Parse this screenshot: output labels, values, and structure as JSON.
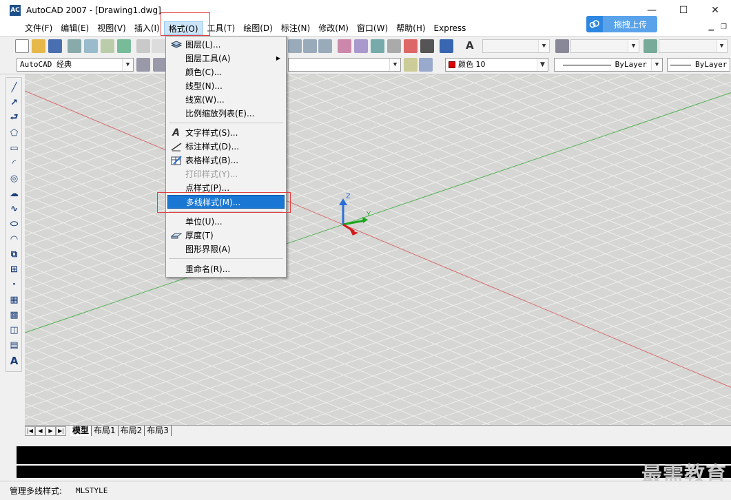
{
  "window": {
    "title": "AutoCAD 2007 - [Drawing1.dwg]",
    "app_icon_text": "AC",
    "minimize": "—",
    "maximize": "☐",
    "close": "✕",
    "cloud_button_label": "拖拽上传"
  },
  "menubar": {
    "items": [
      "文件(F)",
      "编辑(E)",
      "视图(V)",
      "插入(I)",
      "格式(O)",
      "工具(T)",
      "绘图(D)",
      "标注(N)",
      "修改(M)",
      "窗口(W)",
      "帮助(H)",
      "Express"
    ],
    "active_index": 4
  },
  "toolbar2": {
    "workspace": "AutoCAD 经典",
    "color_combo": "颜色 10",
    "linetype_combo": "ByLayer",
    "lineweight_combo": "ByLayer"
  },
  "format_menu": {
    "items": [
      {
        "label": "图层(L)...",
        "icon": "layers-icon",
        "disabled": false
      },
      {
        "label": "图层工具(A)",
        "icon": "",
        "disabled": false,
        "submenu": true
      },
      {
        "label": "颜色(C)...",
        "icon": "",
        "disabled": false
      },
      {
        "label": "线型(N)...",
        "icon": "",
        "disabled": false
      },
      {
        "label": "线宽(W)...",
        "icon": "",
        "disabled": false
      },
      {
        "label": "比例缩放列表(E)...",
        "icon": "",
        "disabled": false
      },
      {
        "label": "文字样式(S)...",
        "icon": "text-style-icon",
        "disabled": false
      },
      {
        "label": "标注样式(D)...",
        "icon": "dim-style-icon",
        "disabled": false
      },
      {
        "label": "表格样式(B)...",
        "icon": "table-style-icon",
        "disabled": false
      },
      {
        "label": "打印样式(Y)...",
        "icon": "",
        "disabled": true
      },
      {
        "label": "点样式(P)...",
        "icon": "",
        "disabled": false
      },
      {
        "label": "多线样式(M)...",
        "icon": "",
        "disabled": false,
        "selected": true
      },
      {
        "label": "单位(U)...",
        "icon": "",
        "disabled": false
      },
      {
        "label": "厚度(T)",
        "icon": "thickness-icon",
        "disabled": false
      },
      {
        "label": "图形界限(A)",
        "icon": "",
        "disabled": false
      },
      {
        "label": "重命名(R)...",
        "icon": "",
        "disabled": false
      }
    ]
  },
  "layout_tabs": [
    "模型",
    "布局1",
    "布局2",
    "布局3"
  ],
  "ucs": {
    "z": "Z",
    "y": "Y"
  },
  "status": {
    "label": "管理多线样式:",
    "command": "MLSTYLE"
  },
  "watermark": "最需教育",
  "colors": {
    "canvas_bg": "#d6d6d4",
    "grid": "#eeeeec",
    "menu_highlight": "#1a78d4",
    "annotation_red": "#e04040",
    "color_swatch": "#e00000"
  }
}
